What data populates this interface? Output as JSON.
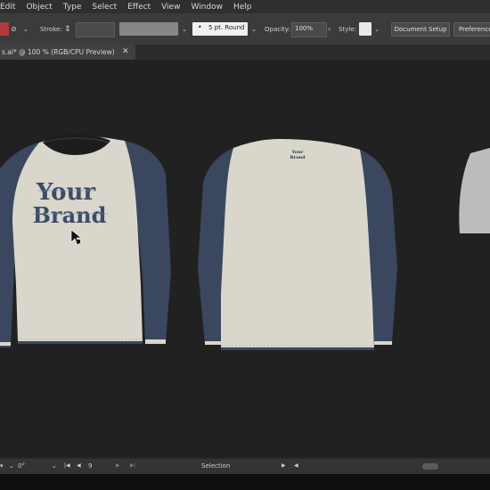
{
  "menu": [
    "Edit",
    "Object",
    "Type",
    "Select",
    "Effect",
    "View",
    "Window",
    "Help"
  ],
  "control": {
    "stroke_label": "Stroke:",
    "brush_value": "5 pt. Round",
    "opacity_label": "Opacity:",
    "opacity_value": "100%",
    "style_label": "Style:",
    "document_setup": "Document Setup",
    "preferences": "Preference"
  },
  "tab": {
    "title": "s.ai* @ 100 % (RGB/CPU Preview)",
    "close": "✕"
  },
  "artwork": {
    "front_text_line1": "Your",
    "front_text_line2": "Brand",
    "back_text_line1": "Your",
    "back_text_line2": "Brand",
    "body_color": "#d9d6cc",
    "sleeve_color": "#3a475f"
  },
  "status": {
    "rotation": "0°",
    "page": "9",
    "tool": "Selection"
  }
}
